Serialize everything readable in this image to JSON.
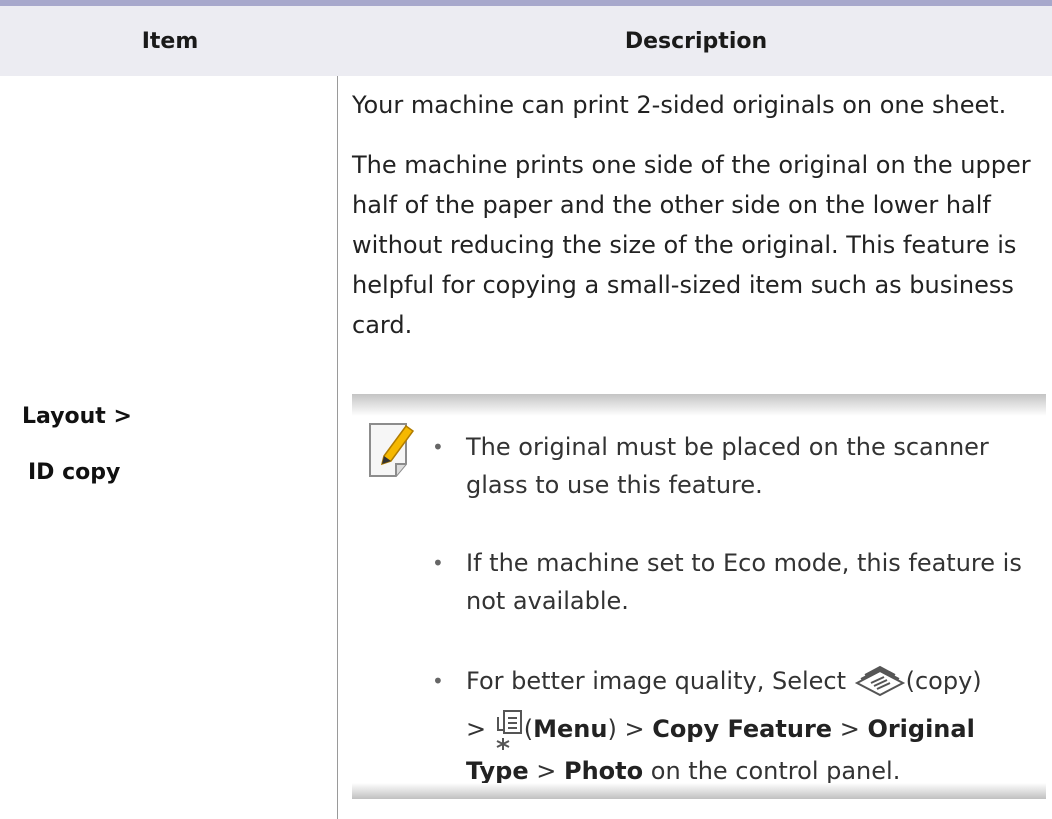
{
  "table": {
    "headers": {
      "item": "Item",
      "description": "Description"
    },
    "row": {
      "item_line1": "Layout >",
      "item_line2": "ID copy",
      "para1": "Your machine can print 2-sided originals on one sheet.",
      "para2": "The machine prints one side of the original on the upper half of the paper and the other side on the lower half without reducing the size of the original. This feature is helpful for copying a small-sized item such as business card."
    }
  },
  "note": {
    "icon": "note-pencil-icon",
    "bullet1": "The original must be placed on the scanner glass to use this feature.",
    "bullet2": "If the machine set to Eco mode, this feature is not available.",
    "bullet3": {
      "p1": "For better image quality, Select ",
      "copy_icon": "copy-icon",
      "p2": "(copy)",
      "p3": "> ",
      "menu_icon": "menu-icon",
      "p4": "(",
      "menu": "Menu",
      "p5": ") > ",
      "copy_feature": "Copy Feature",
      "p6": " > ",
      "original": "Original",
      "type": "Type",
      "p7": " > ",
      "photo": "Photo",
      "p8": " on the control panel."
    }
  }
}
